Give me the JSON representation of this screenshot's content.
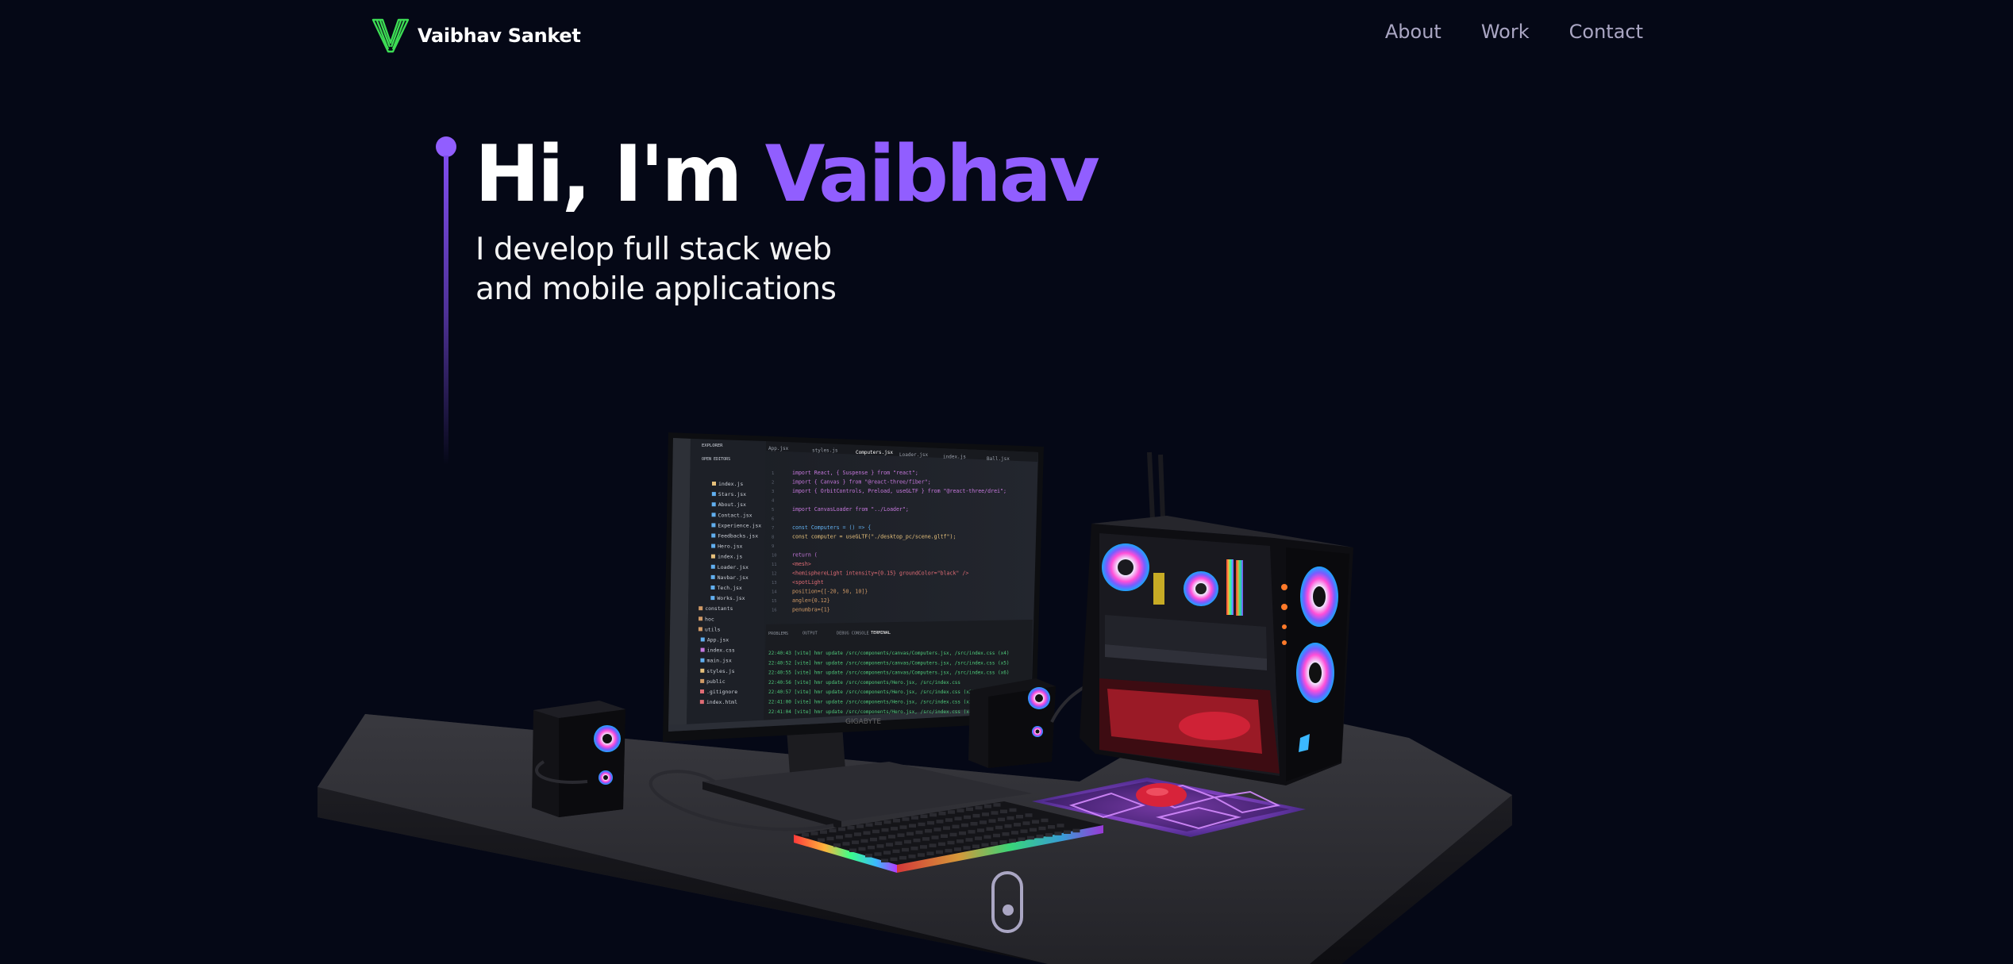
{
  "navbar": {
    "brand_name": "Vaibhav Sanket",
    "links": [
      "About",
      "Work",
      "Contact"
    ]
  },
  "hero": {
    "greeting": "Hi, I'm ",
    "name": "Vaibhav",
    "subtitle_line1": "I develop full stack web",
    "subtitle_line2": "and mobile applications"
  },
  "monitor": {
    "brand_label": "GIGABYTE",
    "explorer_header": "EXPLORER",
    "open_editors": "OPEN EDITORS",
    "files": [
      "index.js",
      "Stars.jsx",
      "About.jsx",
      "Contact.jsx",
      "Experience.jsx",
      "Feedbacks.jsx",
      "Hero.jsx",
      "index.js",
      "Loader.jsx",
      "Navbar.jsx",
      "Tech.jsx",
      "Works.jsx",
      "constants",
      "hoc",
      "utils",
      "App.jsx",
      "index.css",
      "main.jsx",
      "styles.js",
      "public",
      ".gitignore",
      "index.html"
    ],
    "tabs": [
      "App.jsx",
      "styles.js",
      "Computers.jsx",
      "Loader.jsx",
      "index.js",
      "Ball.jsx"
    ],
    "code_lines": [
      "import React, { Suspense } from \"react\";",
      "import { Canvas } from \"@react-three/fiber\";",
      "import { OrbitControls, Preload, useGLTF } from \"@react-three/drei\";",
      "",
      "import CanvasLoader from \"../Loader\";",
      "",
      "const Computers = () => {",
      "  const computer = useGLTF(\"./desktop_pc/scene.gltf\");",
      "",
      "  return (",
      "    <mesh>",
      "      <hemisphereLight intensity={0.15} groundColor=\"black\" />",
      "      <spotLight",
      "        position={[-20, 50, 10]}",
      "        angle={0.12}",
      "        penumbra={1}"
    ],
    "terminal_tabs": [
      "PROBLEMS",
      "OUTPUT",
      "DEBUG CONSOLE",
      "TERMINAL"
    ],
    "terminal_lines": [
      "22:40:43 [vite] hmr update /src/components/canvas/Computers.jsx, /src/index.css (x4)",
      "22:40:52 [vite] hmr update /src/components/canvas/Computers.jsx, /src/index.css (x5)",
      "22:40:55 [vite] hmr update /src/components/canvas/Computers.jsx, /src/index.css (x6)",
      "22:40:56 [vite] hmr update /src/components/Hero.jsx, /src/index.css",
      "22:40:57 [vite] hmr update /src/components/Hero.jsx, /src/index.css (x2)",
      "22:41:00 [vite] hmr update /src/components/Hero.jsx, /src/index.css (x3)",
      "22:41:04 [vite] hmr update /src/components/Hero.jsx, /src/index.css (x4)"
    ]
  },
  "colors": {
    "background": "#050816",
    "accent": "#915eff",
    "nav_text": "#aaa6c3",
    "logo_green": "#3ddc54"
  }
}
